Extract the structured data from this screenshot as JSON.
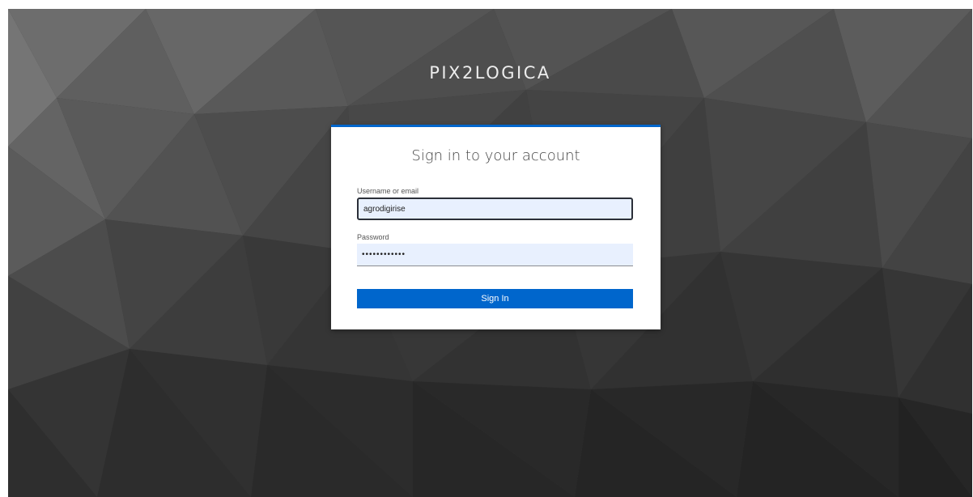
{
  "brand": {
    "name": "PIX2LOGICA"
  },
  "login": {
    "title": "Sign in to your account",
    "username_label": "Username or email",
    "username_value": "agrodigirise",
    "password_label": "Password",
    "password_value": "••••••••••••",
    "submit_label": "Sign In"
  },
  "colors": {
    "accent": "#0066cc",
    "background": "#3a3a3a",
    "field_fill": "#e8f0fe"
  }
}
